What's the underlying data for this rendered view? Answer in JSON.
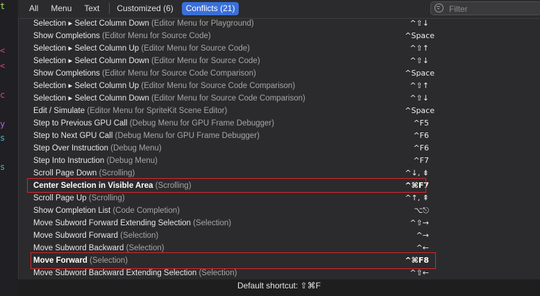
{
  "tabs": [
    {
      "label": "All",
      "active": false
    },
    {
      "label": "Menu",
      "active": false
    },
    {
      "label": "Text",
      "active": false
    },
    {
      "label": "Customized (6)",
      "active": false
    },
    {
      "label": "Conflicts (21)",
      "active": true
    }
  ],
  "filter": {
    "placeholder": "Filter"
  },
  "left_strip": [
    {
      "char": "t",
      "color": "#b0e65a"
    },
    {
      "char": "<",
      "color": "#e0407a"
    },
    {
      "char": "<",
      "color": "#e0407a"
    },
    {
      "char": "c",
      "color": "#e0407a"
    },
    {
      "char": "y",
      "color": "#c25fd6"
    },
    {
      "char": "s",
      "color": "#4ab8c8"
    },
    {
      "char": "s",
      "color": "#4ab8c8"
    }
  ],
  "rows": [
    {
      "command": "Selection ▸ Select Column Down",
      "context": "(Editor Menu for Playground)",
      "shortcut": "^⇧↓"
    },
    {
      "command": "Show Completions",
      "context": "(Editor Menu for Source Code)",
      "shortcut": "^Space"
    },
    {
      "command": "Selection ▸ Select Column Up",
      "context": "(Editor Menu for Source Code)",
      "shortcut": "^⇧↑"
    },
    {
      "command": "Selection ▸ Select Column Down",
      "context": "(Editor Menu for Source Code)",
      "shortcut": "^⇧↓"
    },
    {
      "command": "Show Completions",
      "context": "(Editor Menu for Source Code Comparison)",
      "shortcut": "^Space"
    },
    {
      "command": "Selection ▸ Select Column Up",
      "context": "(Editor Menu for Source Code Comparison)",
      "shortcut": "^⇧↑"
    },
    {
      "command": "Selection ▸ Select Column Down",
      "context": "(Editor Menu for Source Code Comparison)",
      "shortcut": "^⇧↓"
    },
    {
      "command": "Edit / Simulate",
      "context": "(Editor Menu for SpriteKit Scene Editor)",
      "shortcut": "^Space"
    },
    {
      "command": "Step to Previous GPU Call",
      "context": "(Debug Menu for GPU Frame Debugger)",
      "shortcut": "^F5"
    },
    {
      "command": "Step to Next GPU Call",
      "context": "(Debug Menu for GPU Frame Debugger)",
      "shortcut": "^F6"
    },
    {
      "command": "Step Over Instruction",
      "context": "(Debug Menu)",
      "shortcut": "^F6"
    },
    {
      "command": "Step Into Instruction",
      "context": "(Debug Menu)",
      "shortcut": "^F7"
    },
    {
      "command": "Scroll Page Down",
      "context": "(Scrolling)",
      "shortcut": "^↓, ⇟"
    },
    {
      "command": "Center Selection in Visible Area",
      "context": "(Scrolling)",
      "shortcut": "^⌘F7",
      "highlighted": true
    },
    {
      "command": "Scroll Page Up",
      "context": "(Scrolling)",
      "shortcut": "^↑, ⇞"
    },
    {
      "command": "Show Completion List",
      "context": "(Code Completion)",
      "shortcut": "⌥⎋"
    },
    {
      "command": "Move Subword Forward Extending Selection",
      "context": "(Selection)",
      "shortcut": "^⇧→"
    },
    {
      "command": "Move Subword Forward",
      "context": "(Selection)",
      "shortcut": "^→"
    },
    {
      "command": "Move Subword Backward",
      "context": "(Selection)",
      "shortcut": "^←"
    },
    {
      "command": "Move Forward",
      "context": "(Selection)",
      "shortcut": "^⌘F8",
      "highlighted": true
    },
    {
      "command": "Move Subword Backward Extending Selection",
      "context": "(Selection)",
      "shortcut": "^⇧←"
    }
  ],
  "footer": {
    "text": "Default shortcut: ⇧⌘F"
  },
  "colors": {
    "accent": "#3a6fd8",
    "highlight_border": "#d9262b"
  }
}
